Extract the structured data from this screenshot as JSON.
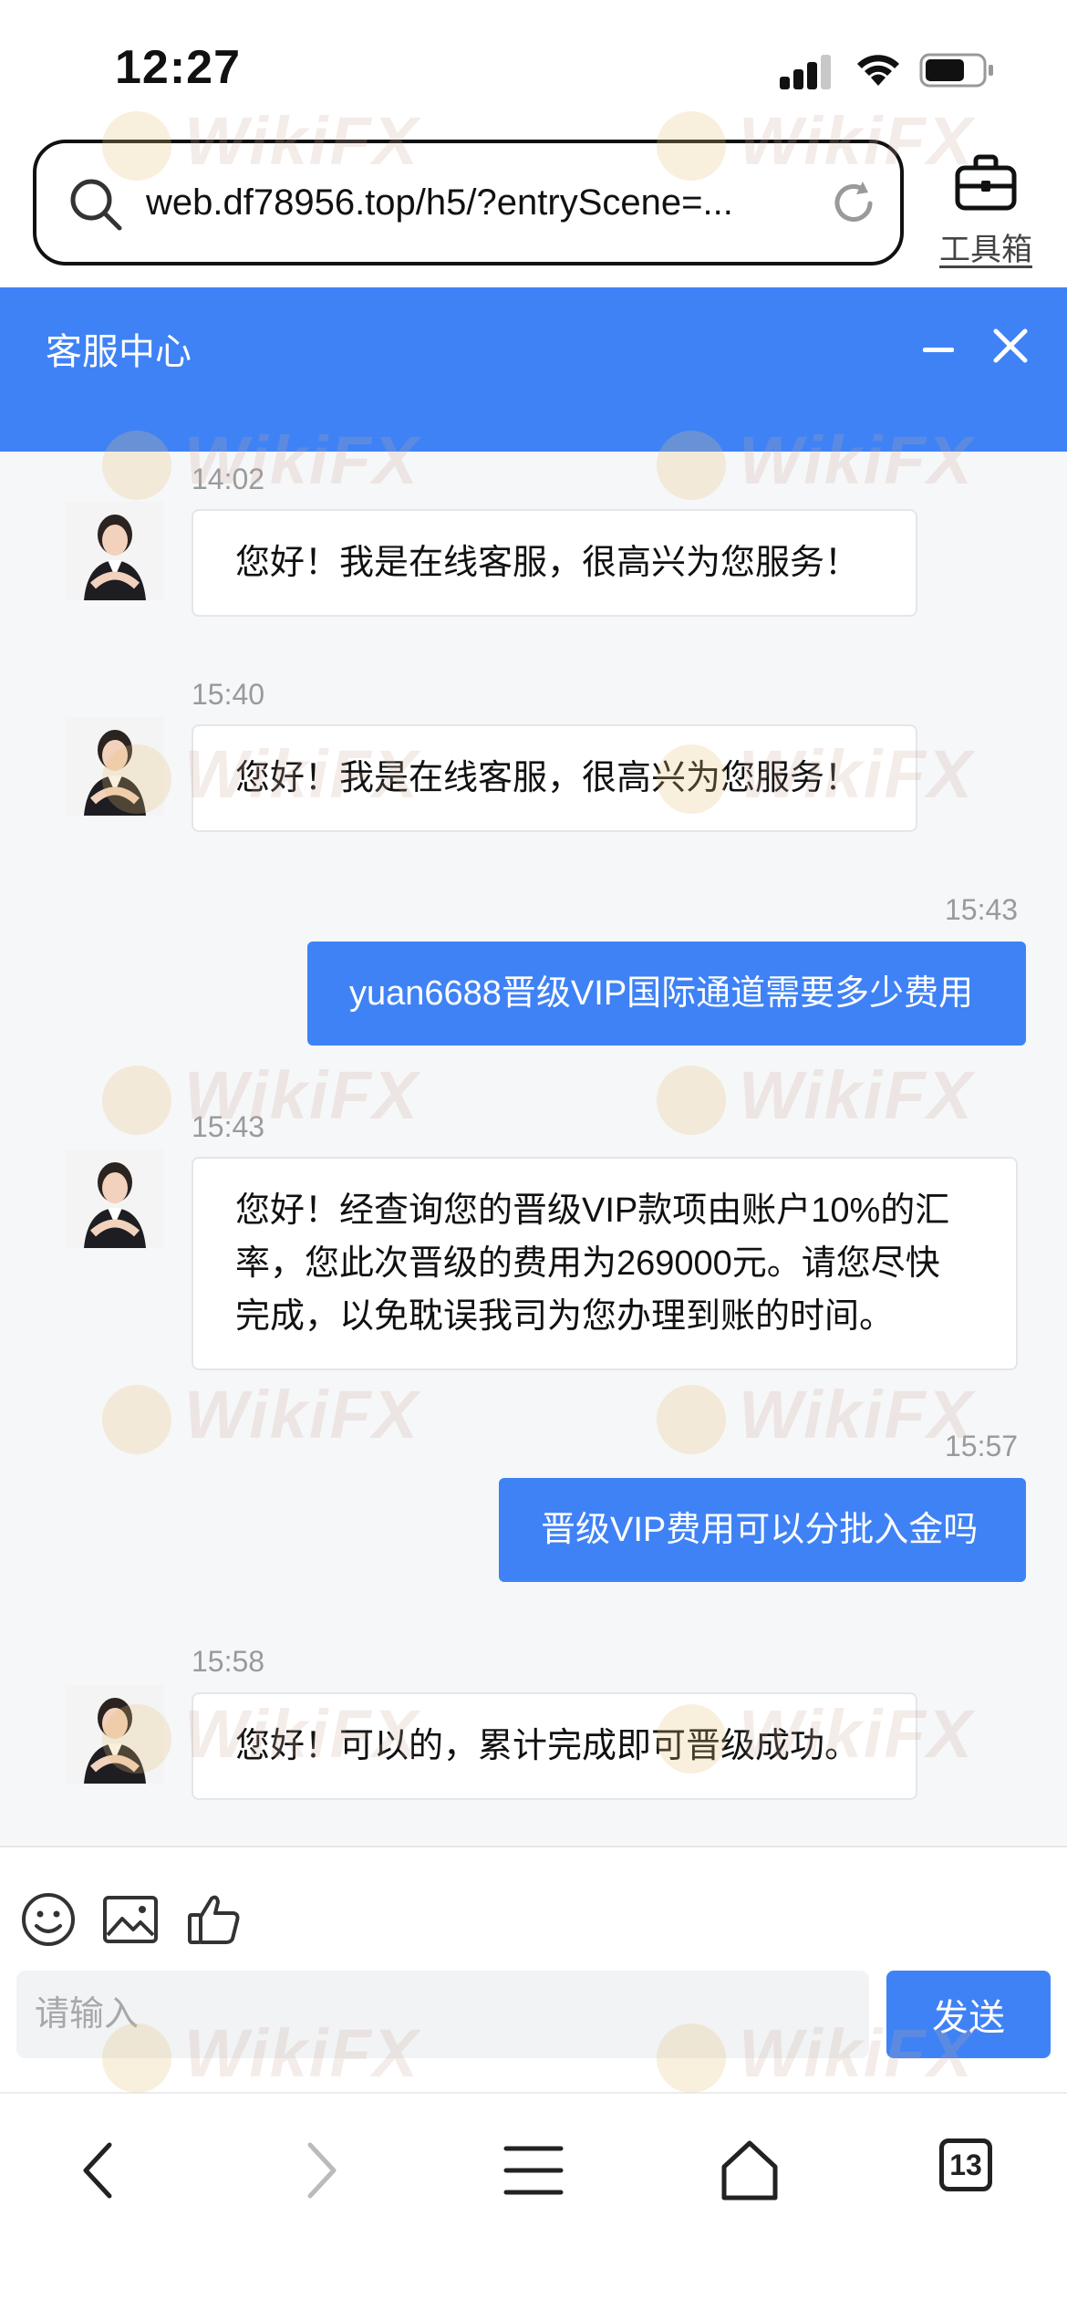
{
  "status_bar": {
    "time": "12:27"
  },
  "browser": {
    "url": "web.df78956.top/h5/?entryScene=...",
    "toolbox_label": "工具箱"
  },
  "chat": {
    "title": "客服中心",
    "messages": [
      {
        "time": "14:02",
        "direction": "in",
        "text": "您好！我是在线客服，很高兴为您服务！"
      },
      {
        "time": "15:40",
        "direction": "in",
        "text": "您好！我是在线客服，很高兴为您服务！"
      },
      {
        "time": "15:43",
        "direction": "out",
        "text": "yuan6688晋级VIP国际通道需要多少费用"
      },
      {
        "time": "15:43",
        "direction": "in",
        "lines": [
          "您好！经查询您的晋级VIP款项由账户10%的汇",
          "率，您此次晋级的费用为269000元。请您尽快",
          "完成，以免耽误我司为您办理到账的时间。"
        ]
      },
      {
        "time": "15:57",
        "direction": "out",
        "text": "晋级VIP费用可以分批入金吗"
      },
      {
        "time": "15:58",
        "direction": "in",
        "text": "您好！可以的，累计完成即可晋级成功。"
      }
    ]
  },
  "input": {
    "placeholder": "请输入",
    "send_label": "发送",
    "tools": [
      "emoji-icon",
      "image-icon",
      "thumbs-up-icon"
    ]
  },
  "bottom_nav": {
    "tab_count": "13",
    "icons": [
      "back-icon",
      "forward-icon",
      "menu-icon",
      "home-icon",
      "tabs-icon"
    ]
  },
  "watermark": {
    "text": "WikiFX"
  },
  "colors": {
    "accent": "#3f82f6",
    "chat_background": "#f6f7f9",
    "timestamp": "#9a9a9a"
  }
}
